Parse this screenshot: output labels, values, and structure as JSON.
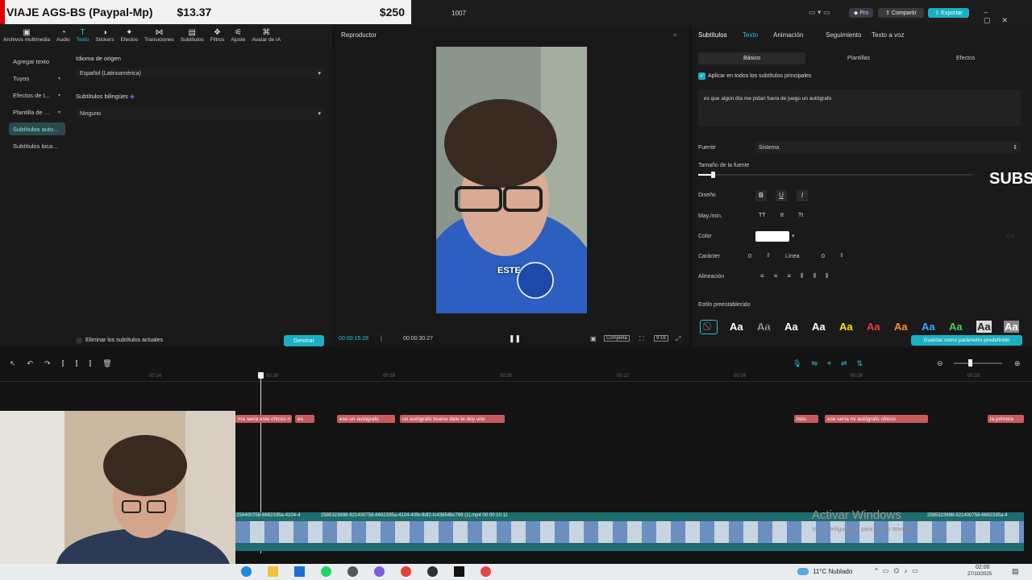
{
  "overlay": {
    "title": "VIAJE AGS-BS (Paypal-Mp)",
    "amount1": "$13.37",
    "amount2": "$250"
  },
  "window": {
    "project_name": "1007",
    "pro_label": "Pro",
    "share_label": "Compartir",
    "export_label": "Exportar"
  },
  "toolbar": [
    "Archivos multimedia",
    "Audio",
    "Texto",
    "Stickers",
    "Efectos",
    "Transiciones",
    "Subtítulos",
    "Filtros",
    "Ajuste",
    "Avatar de IA"
  ],
  "leftnav": [
    "Agregar texto",
    "Tuyos",
    "Efectos de t...",
    "Plantilla de ...",
    "Subtítulos auto...",
    "Subtítulos loca..."
  ],
  "panel": {
    "source_lang_label": "Idioma de origen",
    "source_lang_value": "Español (Latinoamérica)",
    "bilingual_label": "Subtítulos bilingües",
    "bilingual_value": "Ninguno",
    "remove_label": "Eliminar los subtítulos actuales",
    "generate_label": "Generar"
  },
  "player": {
    "title": "Reproductor",
    "current_time": "00:00:15:28",
    "total_time": "00:00:30:27",
    "fit_label": "Completa",
    "ratio_label": "9:16",
    "caption": "ESTE"
  },
  "rpanel": {
    "tabs": [
      "Subtítulos",
      "Texto",
      "Animación",
      "Seguimiento",
      "Texto a voz"
    ],
    "subtabs": [
      "Básico",
      "Plantillas",
      "Efectos"
    ],
    "apply_all": "Aplicar en todos los subtítulos principales",
    "text_value": "es que algún día me pidan fuera de juego un autógrafo",
    "font_label": "Fuente",
    "font_value": "Sistema",
    "size_label": "Tamaño de la fuente",
    "design_label": "Diseño",
    "case_label": "May./min.",
    "color_label": "Color",
    "char_label": "Carácter",
    "char_value": "0",
    "line_label": "Línea",
    "line_value": "0",
    "align_label": "Alineación",
    "preset_label": "Estilo preestablecido",
    "save_preset": "Guardar como parámetro predefinido",
    "side_text": "SUBS"
  },
  "timeline": {
    "ticks": [
      "00:14",
      "00:16",
      "00:18",
      "00:20",
      "00:22",
      "00:24",
      "00:26",
      "00:28"
    ],
    "clips": [
      "ma sería este chicos n",
      "es",
      "eso un autógrafo",
      "un autógrafo bueno dale te doy uno",
      "listo",
      "ese sería mi autógrafo chicos",
      "la primera"
    ],
    "video_labels": [
      "258400758-6662335a-4104-4",
      "2585323698-921400758-6662335a-4104-40fe-8df2-fc43654bc769 (1).mp4  00:00:10:11",
      "2585323698-921400758-6662335a-4"
    ],
    "activate": "Activar Windows",
    "activate_sub": "Ve a Configuración para activar Windows."
  },
  "taskbar": {
    "weather": "11°C  Nublado",
    "time": "02:00",
    "date": "27/10/2025"
  }
}
